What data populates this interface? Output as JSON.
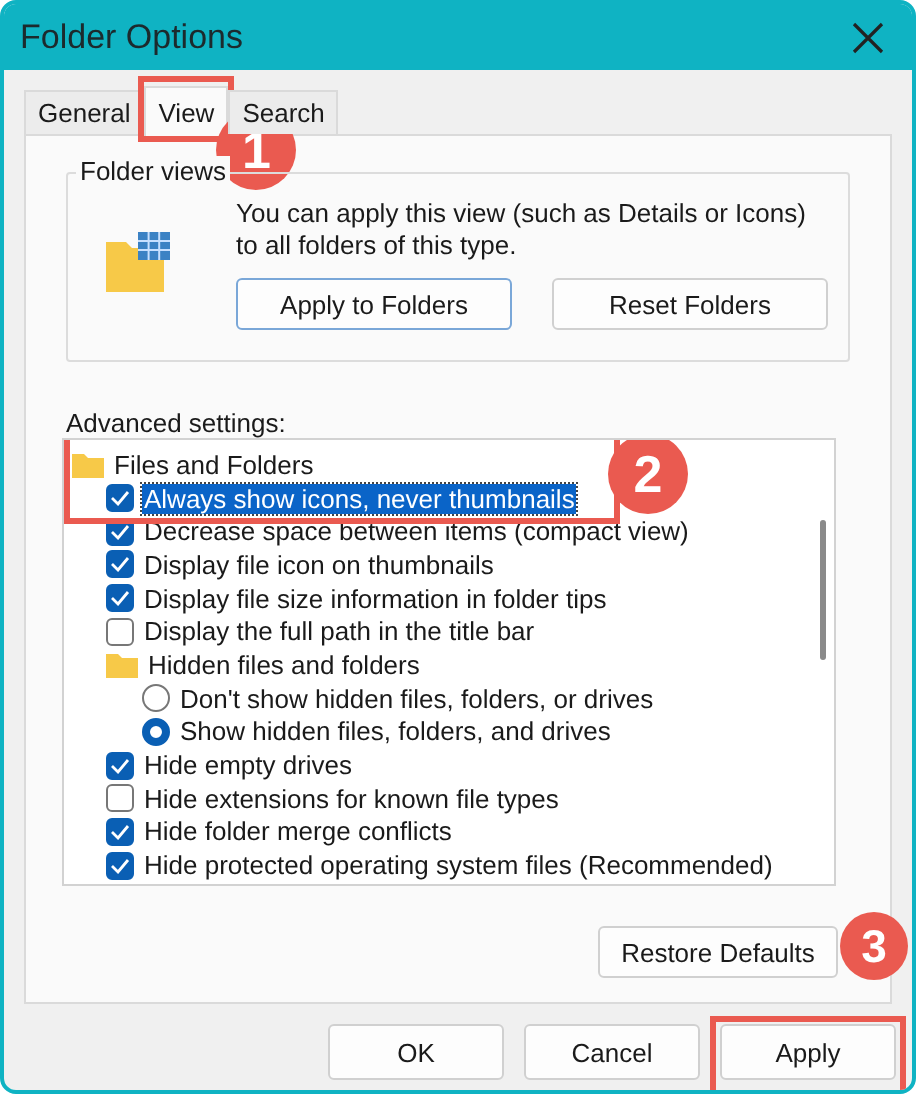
{
  "window": {
    "title": "Folder Options"
  },
  "tabs": [
    {
      "label": "General",
      "selected": false
    },
    {
      "label": "View",
      "selected": true,
      "callout": "1"
    },
    {
      "label": "Search",
      "selected": false
    }
  ],
  "folder_views": {
    "title": "Folder views",
    "description": "You can apply this view (such as Details or Icons) to all folders of this type.",
    "buttons": [
      "Apply to Folders",
      "Reset Folders"
    ]
  },
  "advanced_settings": {
    "label": "Advanced settings:",
    "callout": "2",
    "items": [
      {
        "kind": "folder",
        "label": "Files and Folders",
        "children": [
          {
            "kind": "checkbox",
            "label": "Always show icons, never thumbnails",
            "checked": true,
            "selected": true
          },
          {
            "kind": "checkbox",
            "label": "Decrease space between items (compact view)",
            "checked": true,
            "selected": false
          },
          {
            "kind": "checkbox",
            "label": "Display file icon on thumbnails",
            "checked": true,
            "selected": false
          },
          {
            "kind": "checkbox",
            "label": "Display file size information in folder tips",
            "checked": true,
            "selected": false
          },
          {
            "kind": "checkbox",
            "label": "Display the full path in the title bar",
            "checked": false,
            "selected": false
          },
          {
            "kind": "folder",
            "label": "Hidden files and folders",
            "children": [
              {
                "kind": "radio",
                "label": "Don't show hidden files, folders, or drives",
                "checked": false,
                "selected": false
              },
              {
                "kind": "radio",
                "label": "Show hidden files, folders, and drives",
                "checked": true,
                "selected": false
              }
            ]
          },
          {
            "kind": "checkbox",
            "label": "Hide empty drives",
            "checked": true,
            "selected": false
          },
          {
            "kind": "checkbox",
            "label": "Hide extensions for known file types",
            "checked": false,
            "selected": false
          },
          {
            "kind": "checkbox",
            "label": "Hide folder merge conflicts",
            "checked": true,
            "selected": false
          },
          {
            "kind": "checkbox",
            "label": "Hide protected operating system files (Recommended)",
            "checked": true,
            "selected": false
          }
        ]
      }
    ]
  },
  "restore_button": "Restore Defaults",
  "footer_buttons": [
    {
      "label": "OK"
    },
    {
      "label": "Cancel"
    },
    {
      "label": "Apply",
      "callout": "3"
    }
  ]
}
